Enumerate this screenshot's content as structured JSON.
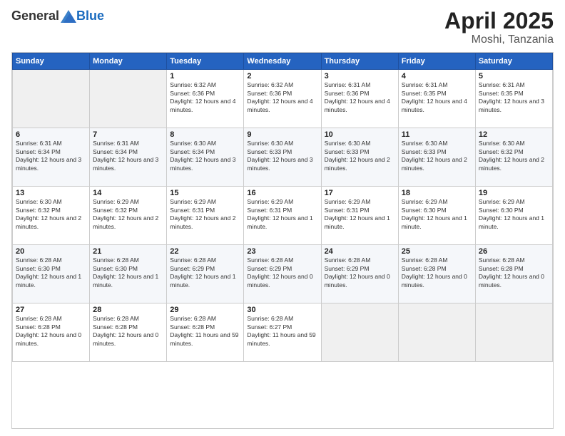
{
  "header": {
    "logo_general": "General",
    "logo_blue": "Blue",
    "month_title": "April 2025",
    "location": "Moshi, Tanzania"
  },
  "days_of_week": [
    "Sunday",
    "Monday",
    "Tuesday",
    "Wednesday",
    "Thursday",
    "Friday",
    "Saturday"
  ],
  "weeks": [
    [
      {
        "day": "",
        "info": ""
      },
      {
        "day": "",
        "info": ""
      },
      {
        "day": "1",
        "info": "Sunrise: 6:32 AM\nSunset: 6:36 PM\nDaylight: 12 hours and 4 minutes."
      },
      {
        "day": "2",
        "info": "Sunrise: 6:32 AM\nSunset: 6:36 PM\nDaylight: 12 hours and 4 minutes."
      },
      {
        "day": "3",
        "info": "Sunrise: 6:31 AM\nSunset: 6:36 PM\nDaylight: 12 hours and 4 minutes."
      },
      {
        "day": "4",
        "info": "Sunrise: 6:31 AM\nSunset: 6:35 PM\nDaylight: 12 hours and 4 minutes."
      },
      {
        "day": "5",
        "info": "Sunrise: 6:31 AM\nSunset: 6:35 PM\nDaylight: 12 hours and 3 minutes."
      }
    ],
    [
      {
        "day": "6",
        "info": "Sunrise: 6:31 AM\nSunset: 6:34 PM\nDaylight: 12 hours and 3 minutes."
      },
      {
        "day": "7",
        "info": "Sunrise: 6:31 AM\nSunset: 6:34 PM\nDaylight: 12 hours and 3 minutes."
      },
      {
        "day": "8",
        "info": "Sunrise: 6:30 AM\nSunset: 6:34 PM\nDaylight: 12 hours and 3 minutes."
      },
      {
        "day": "9",
        "info": "Sunrise: 6:30 AM\nSunset: 6:33 PM\nDaylight: 12 hours and 3 minutes."
      },
      {
        "day": "10",
        "info": "Sunrise: 6:30 AM\nSunset: 6:33 PM\nDaylight: 12 hours and 2 minutes."
      },
      {
        "day": "11",
        "info": "Sunrise: 6:30 AM\nSunset: 6:33 PM\nDaylight: 12 hours and 2 minutes."
      },
      {
        "day": "12",
        "info": "Sunrise: 6:30 AM\nSunset: 6:32 PM\nDaylight: 12 hours and 2 minutes."
      }
    ],
    [
      {
        "day": "13",
        "info": "Sunrise: 6:30 AM\nSunset: 6:32 PM\nDaylight: 12 hours and 2 minutes."
      },
      {
        "day": "14",
        "info": "Sunrise: 6:29 AM\nSunset: 6:32 PM\nDaylight: 12 hours and 2 minutes."
      },
      {
        "day": "15",
        "info": "Sunrise: 6:29 AM\nSunset: 6:31 PM\nDaylight: 12 hours and 2 minutes."
      },
      {
        "day": "16",
        "info": "Sunrise: 6:29 AM\nSunset: 6:31 PM\nDaylight: 12 hours and 1 minute."
      },
      {
        "day": "17",
        "info": "Sunrise: 6:29 AM\nSunset: 6:31 PM\nDaylight: 12 hours and 1 minute."
      },
      {
        "day": "18",
        "info": "Sunrise: 6:29 AM\nSunset: 6:30 PM\nDaylight: 12 hours and 1 minute."
      },
      {
        "day": "19",
        "info": "Sunrise: 6:29 AM\nSunset: 6:30 PM\nDaylight: 12 hours and 1 minute."
      }
    ],
    [
      {
        "day": "20",
        "info": "Sunrise: 6:28 AM\nSunset: 6:30 PM\nDaylight: 12 hours and 1 minute."
      },
      {
        "day": "21",
        "info": "Sunrise: 6:28 AM\nSunset: 6:30 PM\nDaylight: 12 hours and 1 minute."
      },
      {
        "day": "22",
        "info": "Sunrise: 6:28 AM\nSunset: 6:29 PM\nDaylight: 12 hours and 1 minute."
      },
      {
        "day": "23",
        "info": "Sunrise: 6:28 AM\nSunset: 6:29 PM\nDaylight: 12 hours and 0 minutes."
      },
      {
        "day": "24",
        "info": "Sunrise: 6:28 AM\nSunset: 6:29 PM\nDaylight: 12 hours and 0 minutes."
      },
      {
        "day": "25",
        "info": "Sunrise: 6:28 AM\nSunset: 6:28 PM\nDaylight: 12 hours and 0 minutes."
      },
      {
        "day": "26",
        "info": "Sunrise: 6:28 AM\nSunset: 6:28 PM\nDaylight: 12 hours and 0 minutes."
      }
    ],
    [
      {
        "day": "27",
        "info": "Sunrise: 6:28 AM\nSunset: 6:28 PM\nDaylight: 12 hours and 0 minutes."
      },
      {
        "day": "28",
        "info": "Sunrise: 6:28 AM\nSunset: 6:28 PM\nDaylight: 12 hours and 0 minutes."
      },
      {
        "day": "29",
        "info": "Sunrise: 6:28 AM\nSunset: 6:28 PM\nDaylight: 11 hours and 59 minutes."
      },
      {
        "day": "30",
        "info": "Sunrise: 6:28 AM\nSunset: 6:27 PM\nDaylight: 11 hours and 59 minutes."
      },
      {
        "day": "",
        "info": ""
      },
      {
        "day": "",
        "info": ""
      },
      {
        "day": "",
        "info": ""
      }
    ]
  ]
}
